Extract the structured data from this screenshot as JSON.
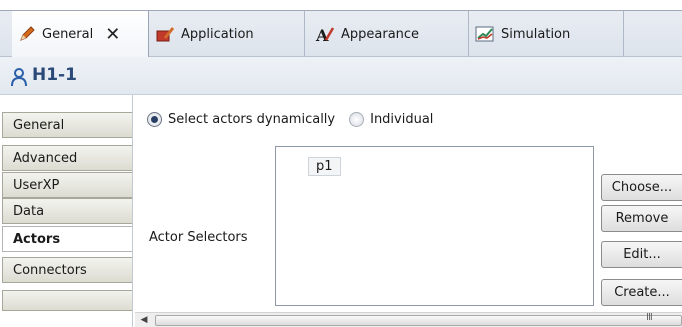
{
  "tabs": [
    {
      "label": "General",
      "icon": "pencil-icon",
      "close": "✕"
    },
    {
      "label": "Application",
      "icon": "application-icon"
    },
    {
      "label": "Appearance",
      "icon": "appearance-icon"
    },
    {
      "label": "Simulation",
      "icon": "simulation-icon"
    }
  ],
  "title": {
    "text": "H1-1",
    "icon": "person-icon"
  },
  "nav": [
    "General",
    "Advanced",
    "UserXP",
    "Data",
    "Actors",
    "Connectors"
  ],
  "nav_active": "Actors",
  "radios": [
    {
      "label": "Select actors dynamically",
      "selected": true
    },
    {
      "label": "Individual",
      "selected": false
    }
  ],
  "actor_selectors": {
    "label": "Actor Selectors",
    "items": [
      "p1"
    ]
  },
  "buttons": [
    "Choose...",
    "Remove",
    "Edit...",
    "Create..."
  ],
  "scrollbar": {
    "left_arrow": "◀",
    "grip": "III"
  },
  "colors": {
    "accent": "#2b4a78",
    "title_bg": "#e2e8ef",
    "nav_bg": "#dcdcd2"
  }
}
